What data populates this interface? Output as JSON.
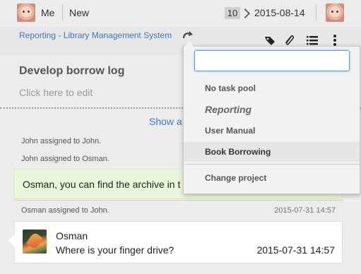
{
  "topbar": {
    "me_label": "Me",
    "new_label": "New",
    "count": "10",
    "date": "2015-08-14"
  },
  "project": {
    "link_text": "Reporting - Library Management System"
  },
  "task": {
    "title": "Develop borrow log",
    "edit_hint": "Click here to edit",
    "show_all": "Show a"
  },
  "activity": {
    "items": [
      {
        "text": "John assigned to John."
      },
      {
        "text": "John assigned to Osman."
      },
      {
        "text": "Osman assigned to John.",
        "time": "2015-07-31 14:57"
      }
    ]
  },
  "comments": [
    {
      "text": "Osman, you can find the archive in t"
    },
    {
      "author": "Osman",
      "text": "Where is your finger drive?",
      "time": "2015-07-31 14:57"
    }
  ],
  "dropdown": {
    "search_value": "",
    "items": [
      {
        "label": "No task pool"
      },
      {
        "label": "Reporting"
      },
      {
        "label": "User Manual"
      },
      {
        "label": "Book Borrowing"
      },
      {
        "label": "Change project"
      }
    ]
  },
  "colors": {
    "link": "#3b77c6",
    "comment_highlight": "#eaf6d9",
    "focus_border": "#5b9bd5"
  },
  "icons": [
    "user-avatar-icon",
    "chevron-right-icon",
    "redo-icon",
    "tag-icon",
    "paperclip-icon",
    "list-icon",
    "more-vertical-icon",
    "osman-avatar"
  ]
}
